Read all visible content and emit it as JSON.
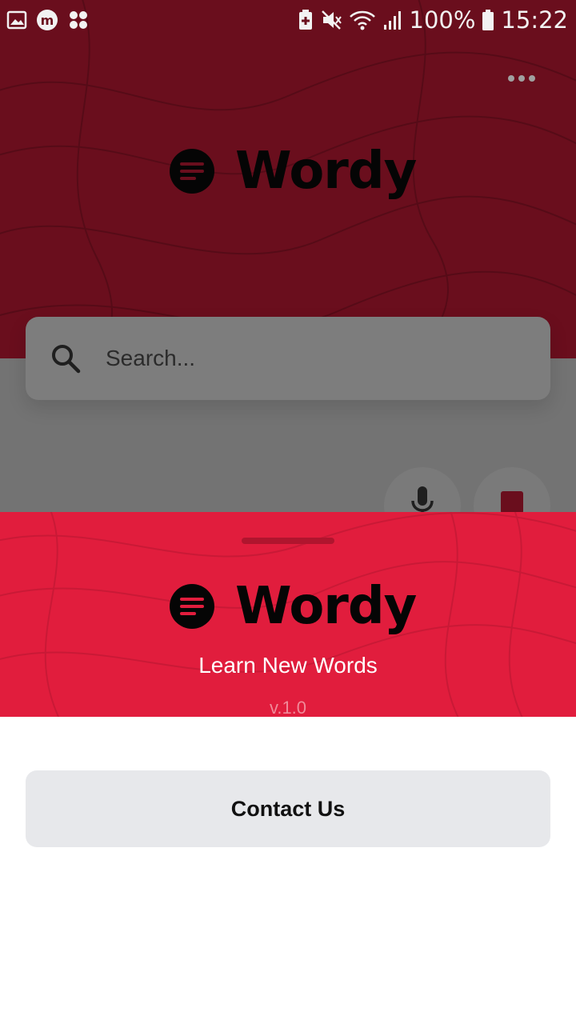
{
  "status_bar": {
    "battery_percent": "100%",
    "time": "15:22",
    "left_icons": [
      "gallery-icon",
      "m-app-icon",
      "apps-grid-icon"
    ],
    "right_icons": [
      "battery-saver-icon",
      "mute-icon",
      "wifi-icon",
      "signal-icon",
      "battery-icon"
    ]
  },
  "header": {
    "more_icon": "more-horizontal-icon",
    "app_name": "Wordy"
  },
  "search": {
    "placeholder": "Search...",
    "value": ""
  },
  "actions": {
    "mic_icon": "microphone-icon",
    "stop_icon": "stop-icon"
  },
  "sheet": {
    "app_name": "Wordy",
    "tagline": "Learn New Words",
    "version": "v.1.0",
    "contact_label": "Contact Us"
  },
  "colors": {
    "brand_red": "#e11d3d",
    "dimmed_red": "#6a0e1d",
    "dim_overlay": "#737373",
    "button_gray": "#e7e8eb"
  }
}
